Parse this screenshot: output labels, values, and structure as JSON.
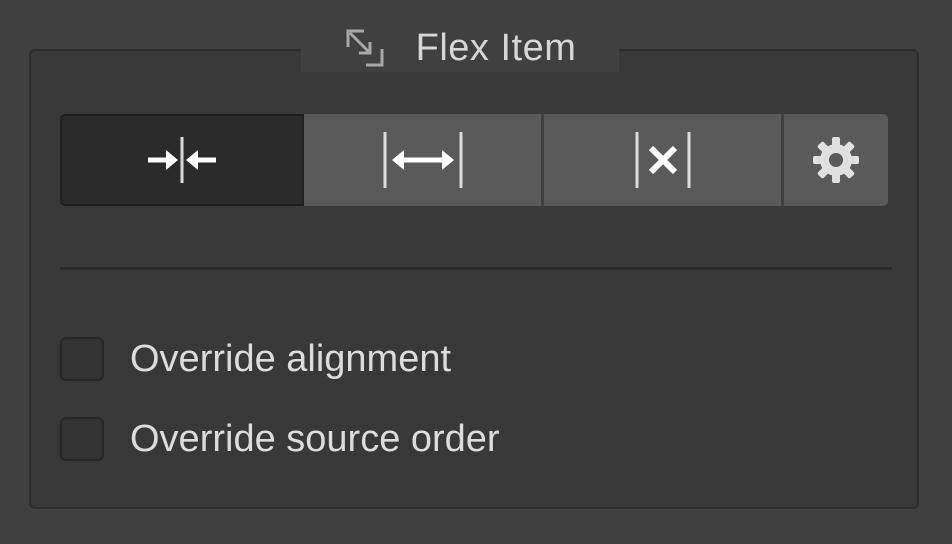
{
  "panel": {
    "title": "Flex Item",
    "title_icon": "resize-corner-icon"
  },
  "sizing_buttons": [
    {
      "name": "shrink",
      "icon": "shrink-arrows-icon",
      "active": true
    },
    {
      "name": "grow",
      "icon": "grow-arrows-icon",
      "active": false
    },
    {
      "name": "none",
      "icon": "no-resize-icon",
      "active": false
    },
    {
      "name": "custom",
      "icon": "gear-icon",
      "active": false
    }
  ],
  "options": {
    "override_alignment": {
      "label": "Override alignment",
      "checked": false
    },
    "override_source_order": {
      "label": "Override source order",
      "checked": false
    }
  },
  "colors": {
    "background": "#404040",
    "panel": "#383838",
    "button": "#5a5a5a",
    "button_active": "#2b2b2b",
    "text": "#d6d6d6"
  }
}
